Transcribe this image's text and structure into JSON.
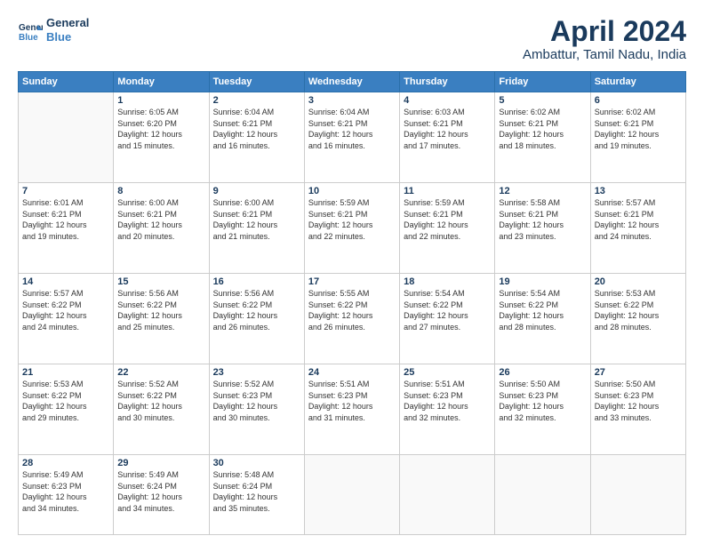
{
  "header": {
    "logo_line1": "General",
    "logo_line2": "Blue",
    "month": "April 2024",
    "location": "Ambattur, Tamil Nadu, India"
  },
  "days_of_week": [
    "Sunday",
    "Monday",
    "Tuesday",
    "Wednesday",
    "Thursday",
    "Friday",
    "Saturday"
  ],
  "weeks": [
    [
      {
        "num": "",
        "info": ""
      },
      {
        "num": "1",
        "info": "Sunrise: 6:05 AM\nSunset: 6:20 PM\nDaylight: 12 hours\nand 15 minutes."
      },
      {
        "num": "2",
        "info": "Sunrise: 6:04 AM\nSunset: 6:21 PM\nDaylight: 12 hours\nand 16 minutes."
      },
      {
        "num": "3",
        "info": "Sunrise: 6:04 AM\nSunset: 6:21 PM\nDaylight: 12 hours\nand 16 minutes."
      },
      {
        "num": "4",
        "info": "Sunrise: 6:03 AM\nSunset: 6:21 PM\nDaylight: 12 hours\nand 17 minutes."
      },
      {
        "num": "5",
        "info": "Sunrise: 6:02 AM\nSunset: 6:21 PM\nDaylight: 12 hours\nand 18 minutes."
      },
      {
        "num": "6",
        "info": "Sunrise: 6:02 AM\nSunset: 6:21 PM\nDaylight: 12 hours\nand 19 minutes."
      }
    ],
    [
      {
        "num": "7",
        "info": "Sunrise: 6:01 AM\nSunset: 6:21 PM\nDaylight: 12 hours\nand 19 minutes."
      },
      {
        "num": "8",
        "info": "Sunrise: 6:00 AM\nSunset: 6:21 PM\nDaylight: 12 hours\nand 20 minutes."
      },
      {
        "num": "9",
        "info": "Sunrise: 6:00 AM\nSunset: 6:21 PM\nDaylight: 12 hours\nand 21 minutes."
      },
      {
        "num": "10",
        "info": "Sunrise: 5:59 AM\nSunset: 6:21 PM\nDaylight: 12 hours\nand 22 minutes."
      },
      {
        "num": "11",
        "info": "Sunrise: 5:59 AM\nSunset: 6:21 PM\nDaylight: 12 hours\nand 22 minutes."
      },
      {
        "num": "12",
        "info": "Sunrise: 5:58 AM\nSunset: 6:21 PM\nDaylight: 12 hours\nand 23 minutes."
      },
      {
        "num": "13",
        "info": "Sunrise: 5:57 AM\nSunset: 6:21 PM\nDaylight: 12 hours\nand 24 minutes."
      }
    ],
    [
      {
        "num": "14",
        "info": "Sunrise: 5:57 AM\nSunset: 6:22 PM\nDaylight: 12 hours\nand 24 minutes."
      },
      {
        "num": "15",
        "info": "Sunrise: 5:56 AM\nSunset: 6:22 PM\nDaylight: 12 hours\nand 25 minutes."
      },
      {
        "num": "16",
        "info": "Sunrise: 5:56 AM\nSunset: 6:22 PM\nDaylight: 12 hours\nand 26 minutes."
      },
      {
        "num": "17",
        "info": "Sunrise: 5:55 AM\nSunset: 6:22 PM\nDaylight: 12 hours\nand 26 minutes."
      },
      {
        "num": "18",
        "info": "Sunrise: 5:54 AM\nSunset: 6:22 PM\nDaylight: 12 hours\nand 27 minutes."
      },
      {
        "num": "19",
        "info": "Sunrise: 5:54 AM\nSunset: 6:22 PM\nDaylight: 12 hours\nand 28 minutes."
      },
      {
        "num": "20",
        "info": "Sunrise: 5:53 AM\nSunset: 6:22 PM\nDaylight: 12 hours\nand 28 minutes."
      }
    ],
    [
      {
        "num": "21",
        "info": "Sunrise: 5:53 AM\nSunset: 6:22 PM\nDaylight: 12 hours\nand 29 minutes."
      },
      {
        "num": "22",
        "info": "Sunrise: 5:52 AM\nSunset: 6:22 PM\nDaylight: 12 hours\nand 30 minutes."
      },
      {
        "num": "23",
        "info": "Sunrise: 5:52 AM\nSunset: 6:23 PM\nDaylight: 12 hours\nand 30 minutes."
      },
      {
        "num": "24",
        "info": "Sunrise: 5:51 AM\nSunset: 6:23 PM\nDaylight: 12 hours\nand 31 minutes."
      },
      {
        "num": "25",
        "info": "Sunrise: 5:51 AM\nSunset: 6:23 PM\nDaylight: 12 hours\nand 32 minutes."
      },
      {
        "num": "26",
        "info": "Sunrise: 5:50 AM\nSunset: 6:23 PM\nDaylight: 12 hours\nand 32 minutes."
      },
      {
        "num": "27",
        "info": "Sunrise: 5:50 AM\nSunset: 6:23 PM\nDaylight: 12 hours\nand 33 minutes."
      }
    ],
    [
      {
        "num": "28",
        "info": "Sunrise: 5:49 AM\nSunset: 6:23 PM\nDaylight: 12 hours\nand 34 minutes."
      },
      {
        "num": "29",
        "info": "Sunrise: 5:49 AM\nSunset: 6:24 PM\nDaylight: 12 hours\nand 34 minutes."
      },
      {
        "num": "30",
        "info": "Sunrise: 5:48 AM\nSunset: 6:24 PM\nDaylight: 12 hours\nand 35 minutes."
      },
      {
        "num": "",
        "info": ""
      },
      {
        "num": "",
        "info": ""
      },
      {
        "num": "",
        "info": ""
      },
      {
        "num": "",
        "info": ""
      }
    ]
  ]
}
